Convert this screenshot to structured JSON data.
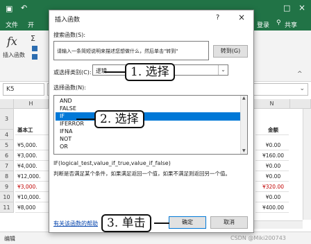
{
  "excel": {
    "save_icon": "save-icon",
    "undo_icon": "undo-icon",
    "tabs": [
      "文件",
      "开"
    ],
    "login": "登录",
    "share": "共享",
    "fx_symbol": "fx",
    "insert_function_label": "插入函数",
    "sigma": "Σ",
    "namebox": "K5",
    "col_headers": [
      "H",
      "N"
    ],
    "col_a_header": "4",
    "row_numbers": [
      "3",
      "4",
      "5",
      "6",
      "7",
      "8",
      "9",
      "10",
      "11"
    ],
    "header_cell": "基本工",
    "amount_header": "金额",
    "left_values": [
      "¥5,000.",
      "¥3,000.",
      "¥4,000.",
      "¥12,000.",
      "¥3,000.",
      "¥10,000.",
      "¥8,000"
    ],
    "right_values": [
      "¥0.00",
      "¥160.00",
      "¥0.00",
      "¥0.00",
      "¥320.00",
      "¥0.00",
      "¥400.00"
    ],
    "status_left": "编辑",
    "watermark": "CSDN @Miki200743"
  },
  "dialog": {
    "title": "插入函数",
    "help": "?",
    "close": "×",
    "search_label": "搜索函数(S):",
    "search_value": "请输入一条简短说明来描述您想做什么，然后单击\"转到\"",
    "goto_button": "转到(G)",
    "category_label": "或选择类别(C):",
    "category_value": "逻辑",
    "list_label": "选择函数(N):",
    "functions": [
      "AND",
      "FALSE",
      "IF",
      "IFERROR",
      "IFNA",
      "NOT",
      "OR"
    ],
    "selected_function": "IF",
    "signature": "IF(logical_test,value_if_true,value_if_false)",
    "description": "判断是否满足某个条件，如果满足返回一个值，如果不满足则返回另一个值。",
    "help_link": "有关该函数的帮助",
    "ok_button": "确定",
    "cancel_button": "取消"
  },
  "annotations": {
    "step1": "1. 选择",
    "step2": "2. 选择",
    "step3": "3. 单击"
  },
  "colors": {
    "excel_green": "#217346",
    "selection_blue": "#0078d7",
    "red_text": "#c00000"
  }
}
